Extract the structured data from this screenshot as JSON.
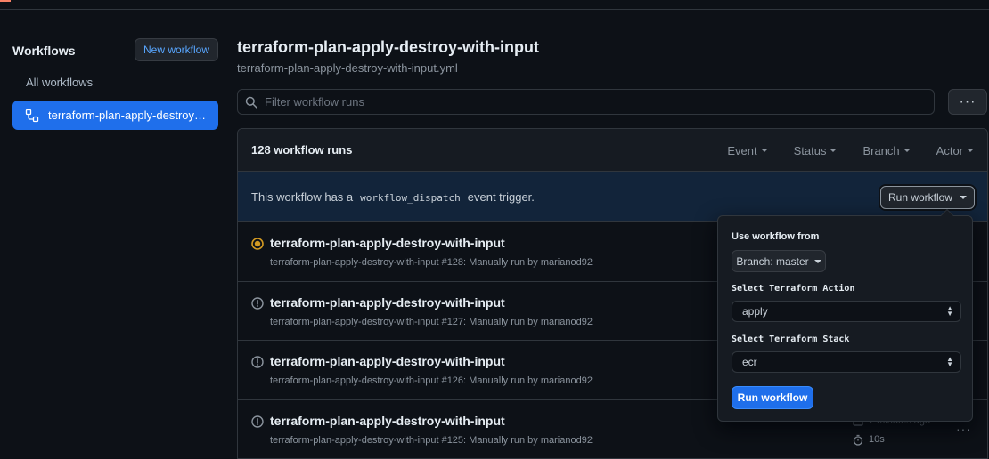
{
  "sidebar": {
    "title": "Workflows",
    "new_workflow_label": "New workflow",
    "all_workflows_label": "All workflows",
    "active_workflow_label": "terraform-plan-apply-destroy-with-input"
  },
  "main": {
    "title": "terraform-plan-apply-destroy-with-input",
    "filename": "terraform-plan-apply-destroy-with-input.yml",
    "filter_placeholder": "Filter workflow runs",
    "more_label": "···"
  },
  "runs": {
    "count_label": "128 workflow runs",
    "filters": [
      "Event",
      "Status",
      "Branch",
      "Actor"
    ],
    "dispatch": {
      "text_before": "This workflow has a",
      "code": "workflow_dispatch",
      "text_after": "event trigger.",
      "button_label": "Run workflow"
    },
    "items": [
      {
        "title": "terraform-plan-apply-destroy-with-input",
        "meta": "terraform-plan-apply-destroy-with-input #128: Manually run by marianod92",
        "status": "in-progress",
        "time": "",
        "duration": ""
      },
      {
        "title": "terraform-plan-apply-destroy-with-input",
        "meta": "terraform-plan-apply-destroy-with-input #127: Manually run by marianod92",
        "status": "warning",
        "time": "",
        "duration": ""
      },
      {
        "title": "terraform-plan-apply-destroy-with-input",
        "meta": "terraform-plan-apply-destroy-with-input #126: Manually run by marianod92",
        "status": "warning",
        "time": "",
        "duration": ""
      },
      {
        "title": "terraform-plan-apply-destroy-with-input",
        "meta": "terraform-plan-apply-destroy-with-input #125: Manually run by marianod92",
        "status": "warning",
        "time": "7 minutes ago",
        "duration": "10s"
      }
    ]
  },
  "popover": {
    "use_from_label": "Use workflow from",
    "branch_label": "Branch: master",
    "action_label": "Select Terraform Action",
    "action_value": "apply",
    "stack_label": "Select Terraform Stack",
    "stack_value": "ecr",
    "submit_label": "Run workflow"
  },
  "colors": {
    "background": "#0d1117",
    "accent_blue": "#1f6feb",
    "in_progress": "#d29922",
    "muted": "#8b949e"
  }
}
